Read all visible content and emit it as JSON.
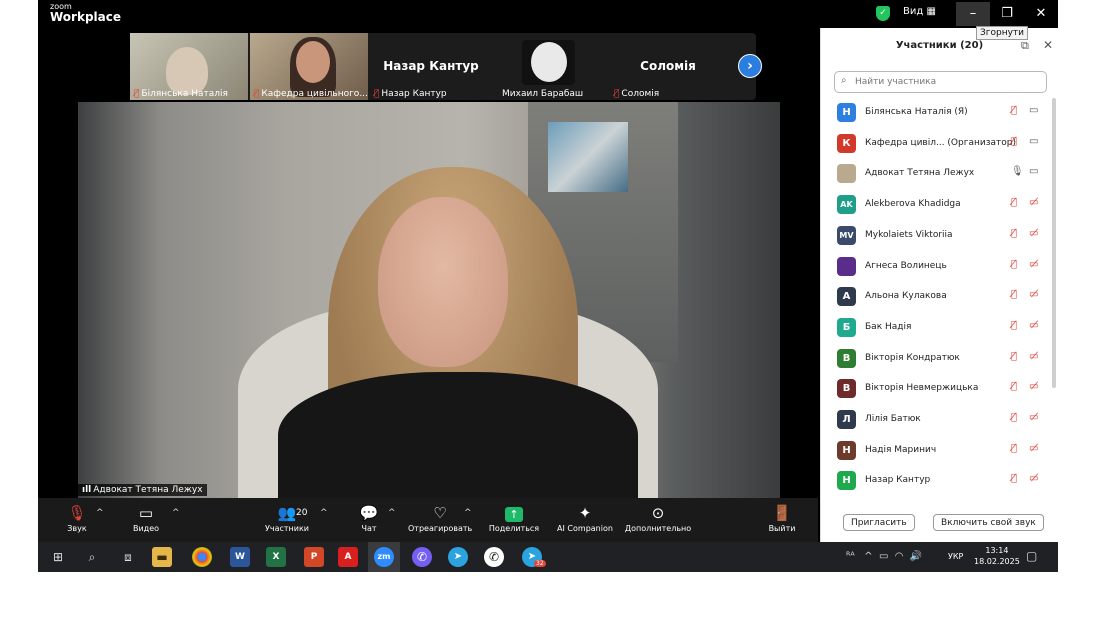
{
  "app": {
    "logo_small": "zoom",
    "logo_big": "Workplace"
  },
  "titlebar": {
    "view_label": "Вид ▦",
    "tooltip": "Згорнути"
  },
  "thumbnails": [
    {
      "name": "Білянська Наталія",
      "muted": true
    },
    {
      "name": "Кафедра цивільного...",
      "muted": true
    },
    {
      "name": "Назар Кантур",
      "display": "Назар Кантур",
      "muted": true
    },
    {
      "name": "Михаил Барабаш",
      "muted": false
    },
    {
      "name": "Соломія",
      "display": "Соломія",
      "muted": true
    }
  ],
  "main_video": {
    "speaker": "Адвокат Тетяна Лежух"
  },
  "toolbar": {
    "audio": "Звук",
    "video": "Видео",
    "participants": "Участники",
    "participants_count": "20",
    "chat": "Чат",
    "react": "Отреагировать",
    "share": "Поделиться",
    "ai": "AI Companion",
    "more": "Дополнительно",
    "leave": "Выйти"
  },
  "panel": {
    "title": "Участники (20)",
    "search_placeholder": "Найти участника",
    "participants": [
      {
        "initials": "Н",
        "color": "#2d7fe0",
        "name": "Білянська Наталія (Я)",
        "mic_on": false,
        "cam_on": true
      },
      {
        "initials": "К",
        "color": "#d2392b",
        "name": "Кафедра цивіл... (Организатор)",
        "mic_on": false,
        "cam_on": true
      },
      {
        "initials": "",
        "color": "#b9a98e",
        "name": "Адвокат Тетяна Лежух",
        "mic_on": true,
        "cam_on": true
      },
      {
        "initials": "AK",
        "color": "#1f9e8a",
        "name": "Alekberova Khadidga",
        "mic_on": false,
        "cam_on": false
      },
      {
        "initials": "MV",
        "color": "#3b4a6b",
        "name": "Mykolaiets Viktoriia",
        "mic_on": false,
        "cam_on": false
      },
      {
        "initials": "",
        "color": "#5b2d8a",
        "name": "Агнеса Волинець",
        "mic_on": false,
        "cam_on": false
      },
      {
        "initials": "А",
        "color": "#2f3a4c",
        "name": "Альона Кулакова",
        "mic_on": false,
        "cam_on": false
      },
      {
        "initials": "Б",
        "color": "#1fa98e",
        "name": "Бак Надія",
        "mic_on": false,
        "cam_on": false
      },
      {
        "initials": "В",
        "color": "#2e7d32",
        "name": "Вікторія Кондратюк",
        "mic_on": false,
        "cam_on": false
      },
      {
        "initials": "В",
        "color": "#6d2b2b",
        "name": "Вікторія Невмержицька",
        "mic_on": false,
        "cam_on": false
      },
      {
        "initials": "Л",
        "color": "#2f3a4c",
        "name": "Лілія Батюк",
        "mic_on": false,
        "cam_on": false
      },
      {
        "initials": "Н",
        "color": "#6d3b2b",
        "name": "Надія Маринич",
        "mic_on": false,
        "cam_on": false
      },
      {
        "initials": "Н",
        "color": "#1fa94e",
        "name": "Назар Кантур",
        "mic_on": false,
        "cam_on": false
      }
    ],
    "invite": "Пригласить",
    "unmute": "Включить свой звук"
  },
  "taskbar": {
    "word": "W",
    "excel": "X",
    "ppt": "P",
    "acrobat": "A",
    "zoom": "zm",
    "badge": "32",
    "lang": "УКР",
    "time": "13:14",
    "date": "18.02.2025"
  }
}
